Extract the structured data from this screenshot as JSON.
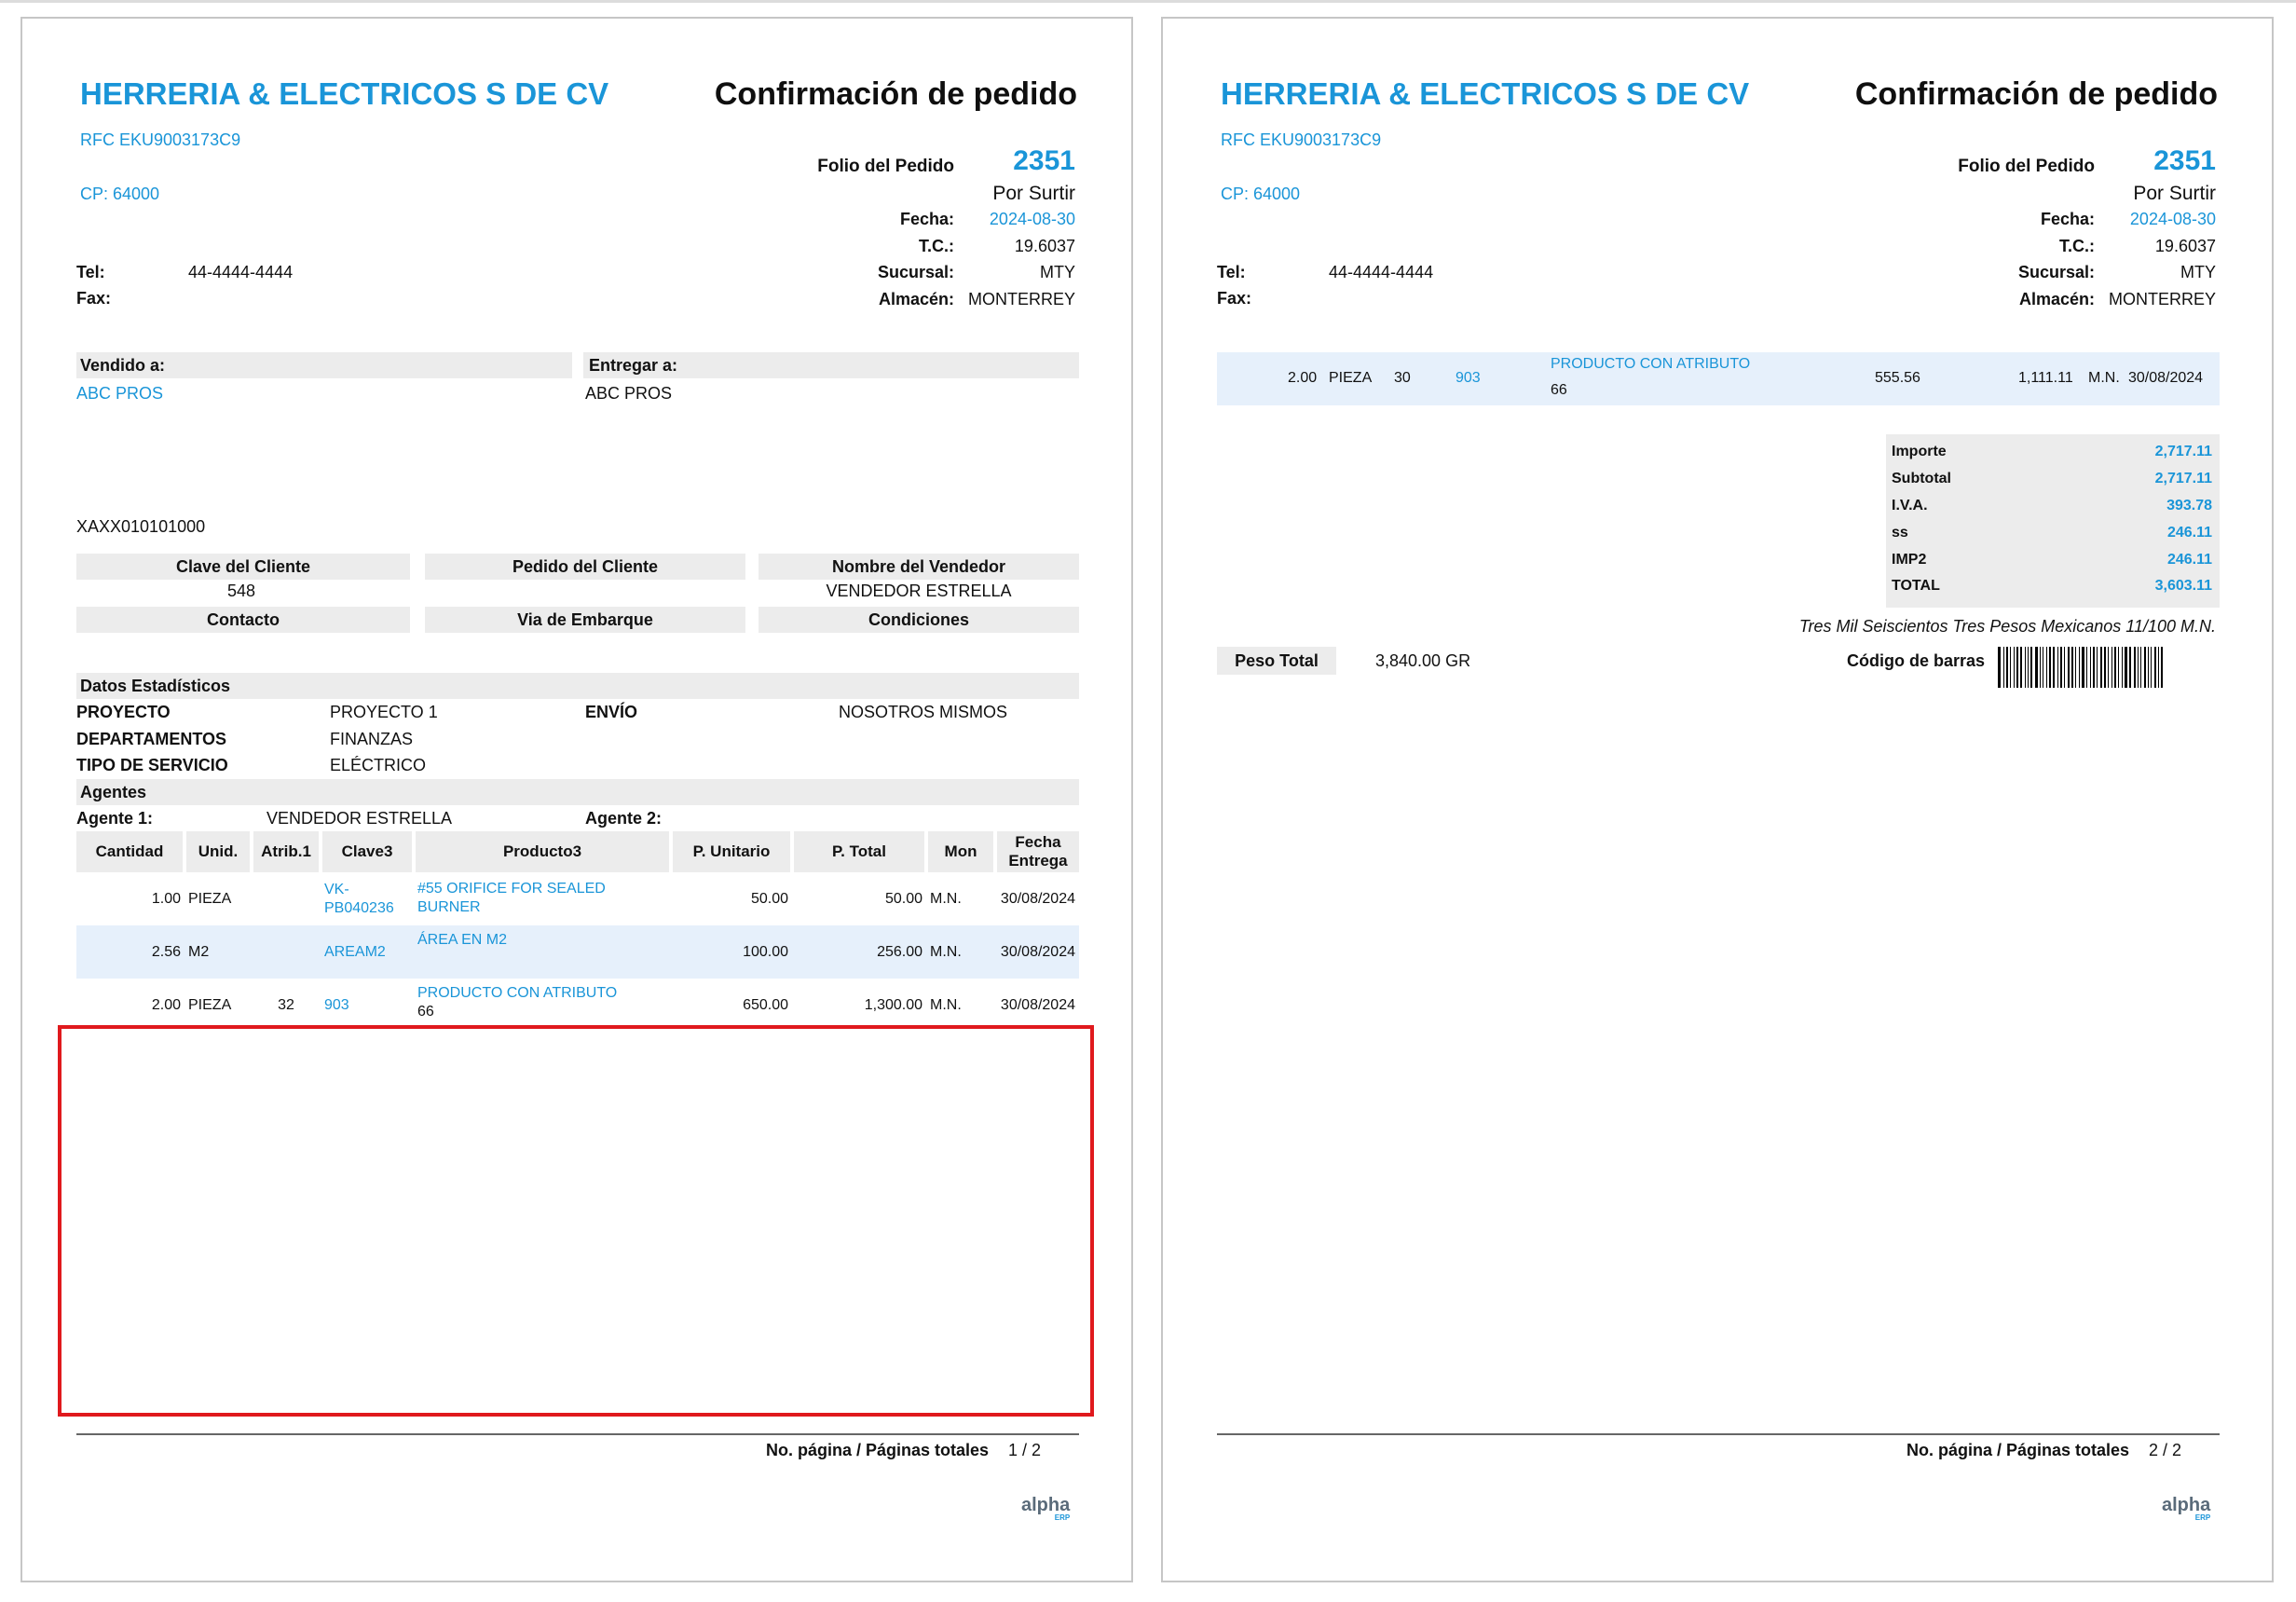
{
  "company": {
    "name": "HERRERIA & ELECTRICOS S DE CV",
    "rfc": "RFC EKU9003173C9",
    "cp": "CP: 64000",
    "tel_label": "Tel:",
    "tel": "44-4444-4444",
    "fax_label": "Fax:"
  },
  "doc": {
    "title": "Confirmación de pedido",
    "folio_label": "Folio del Pedido",
    "folio": "2351",
    "status": "Por Surtir",
    "fecha_label": "Fecha:",
    "fecha": "2024-08-30",
    "tc_label": "T.C.:",
    "tc": "19.6037",
    "sucursal_label": "Sucursal:",
    "sucursal": "MTY",
    "almacen_label": "Almacén:",
    "almacen": "MONTERREY"
  },
  "parties": {
    "vendido_label": "Vendido a:",
    "vendido": "ABC PROS",
    "entregar_label": "Entregar a:",
    "entregar": "ABC PROS",
    "rfc_cliente": "XAXX010101000"
  },
  "info": {
    "clave_cliente_label": "Clave del Cliente",
    "clave_cliente": "548",
    "pedido_cliente_label": "Pedido del Cliente",
    "vendedor_label": "Nombre del Vendedor",
    "vendedor": "VENDEDOR ESTRELLA",
    "contacto_label": "Contacto",
    "via_label": "Via de Embarque",
    "condiciones_label": "Condiciones"
  },
  "stats": {
    "title": "Datos Estadísticos",
    "proyecto_label": "PROYECTO",
    "proyecto": "PROYECTO 1",
    "envio_label": "ENVÍO",
    "envio": "NOSOTROS MISMOS",
    "departamentos_label": "DEPARTAMENTOS",
    "departamentos": "FINANZAS",
    "tipo_label": "TIPO DE SERVICIO",
    "tipo": "ELÉCTRICO"
  },
  "agents": {
    "title": "Agentes",
    "agente1_label": "Agente 1:",
    "agente1": "VENDEDOR ESTRELLA",
    "agente2_label": "Agente 2:"
  },
  "table": {
    "headers": [
      "Cantidad",
      "Unid.",
      "Atrib.1",
      "Clave3",
      "Producto3",
      "P. Unitario",
      "P. Total",
      "Mon",
      "Fecha Entrega"
    ],
    "rows": [
      {
        "qty": "1.00",
        "unit": "PIEZA",
        "attr": "",
        "clave": "VK-PB040236",
        "producto": "#55 ORIFICE FOR SEALED BURNER",
        "producto2": "",
        "punit": "50.00",
        "ptotal": "50.00",
        "mon": "M.N.",
        "fecha": "30/08/2024"
      },
      {
        "qty": "2.56",
        "unit": "M2",
        "attr": "",
        "clave": "AREAM2",
        "producto": "ÁREA EN M2",
        "producto2": "",
        "punit": "100.00",
        "ptotal": "256.00",
        "mon": "M.N.",
        "fecha": "30/08/2024"
      },
      {
        "qty": "2.00",
        "unit": "PIEZA",
        "attr": "32",
        "clave": "903",
        "producto": "PRODUCTO CON ATRIBUTO",
        "producto2": "66",
        "punit": "650.00",
        "ptotal": "1,300.00",
        "mon": "M.N.",
        "fecha": "30/08/2024"
      }
    ]
  },
  "page2_row": {
    "qty": "2.00",
    "unit": "PIEZA",
    "attr": "30",
    "clave": "903",
    "producto": "PRODUCTO CON ATRIBUTO",
    "producto2": "66",
    "punit": "555.56",
    "ptotal": "1,111.11",
    "mon": "M.N.",
    "fecha": "30/08/2024"
  },
  "totals": {
    "importe_label": "Importe",
    "importe": "2,717.11",
    "subtotal_label": "Subtotal",
    "subtotal": "2,717.11",
    "iva_label": "I.V.A.",
    "iva": "393.78",
    "ss_label": "ss",
    "ss": "246.11",
    "imp2_label": "IMP2",
    "imp2": "246.11",
    "total_label": "TOTAL",
    "total": "3,603.11",
    "letra": "Tres Mil Seiscientos Tres  Pesos Mexicanos 11/100 M.N."
  },
  "weight": {
    "label": "Peso Total",
    "value": "3,840.00 GR"
  },
  "barcode_label": "Código de barras",
  "footer": {
    "label": "No. página / Páginas totales",
    "page1": "1 / 2",
    "page2": "2 / 2",
    "logo_main": "alpha",
    "logo_sub": "ERP"
  },
  "colors": {
    "accent": "#1a95d8",
    "highlight_row": "#e6f0fb",
    "label_bg": "#ececec",
    "annotation": "#e0191d"
  }
}
